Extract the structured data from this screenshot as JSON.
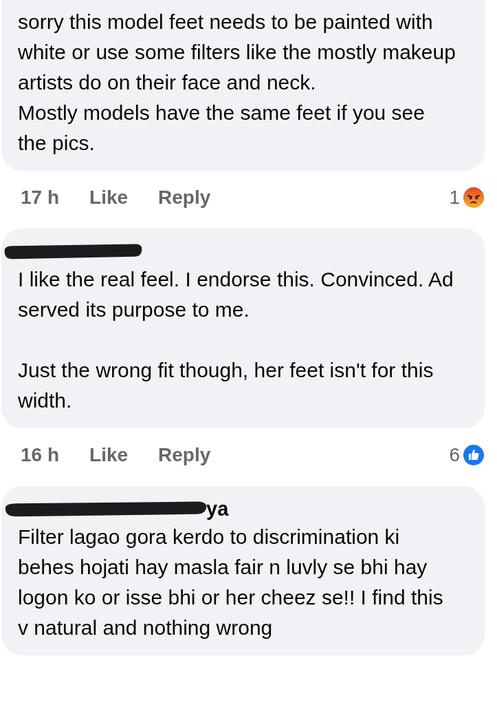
{
  "comments": [
    {
      "redacted": false,
      "text": "sorry this model feet needs to be painted with white or use some filters like the mostly makeup artists do on their face and neck.\nMostly models have the same feet if you see the pics.",
      "time": "17 h",
      "like": "Like",
      "reply": "Reply",
      "reaction": {
        "kind": "angry",
        "count": "1"
      }
    },
    {
      "redacted": true,
      "text": "I like the real feel. I endorse this. Convinced. Ad served its purpose to me.\n\nJust the wrong fit though, her feet isn't for this width.",
      "time": "16 h",
      "like": "Like",
      "reply": "Reply",
      "reaction": {
        "kind": "like",
        "count": "6"
      }
    },
    {
      "redacted": true,
      "author_visible": "ya",
      "text": "Filter lagao gora kerdo to discrimination ki behes hojati hay masla fair n luvly se bhi hay logon ko or isse bhi or her cheez se!! I find this v natural and nothing wrong"
    }
  ]
}
